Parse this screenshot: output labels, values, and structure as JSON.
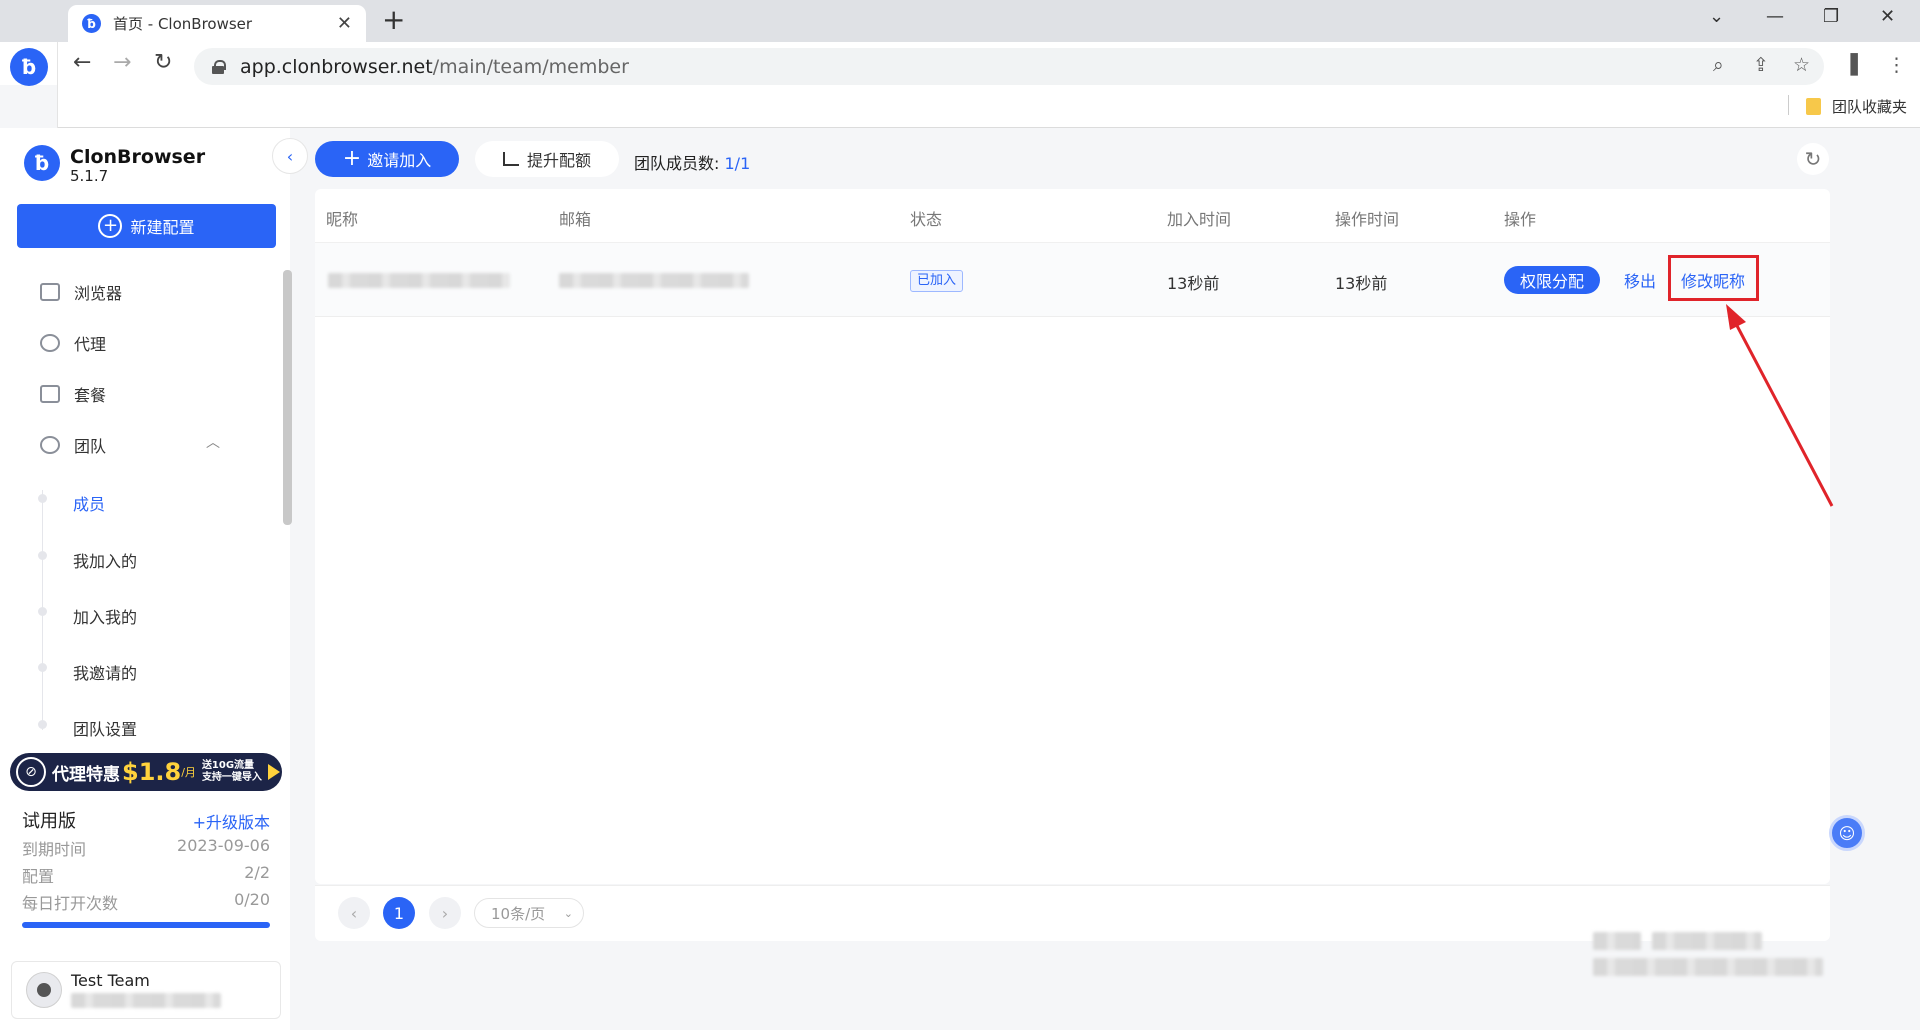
{
  "browser": {
    "tab_title": "首页 - ClonBrowser",
    "favicon_glyph": "ƀ",
    "new_tab": "+",
    "url_host": "app.clonbrowser.net",
    "url_path": "/main/team/member",
    "bookmark_folder": "团队收藏夹",
    "icons": [
      "back-icon",
      "forward-icon",
      "reload-icon",
      "zoom-icon",
      "share-icon",
      "star-icon",
      "sidepanel-icon",
      "menu-icon"
    ]
  },
  "sidebar": {
    "brand_name": "ClonBrowser",
    "version": "5.1.7",
    "new_config_label": "新建配置",
    "nav": [
      {
        "label": "浏览器",
        "icon": "browser-icon"
      },
      {
        "label": "代理",
        "icon": "globe-icon"
      },
      {
        "label": "套餐",
        "icon": "wallet-icon"
      },
      {
        "label": "团队",
        "icon": "team-icon"
      }
    ],
    "team_sub": [
      "成员",
      "我加入的",
      "加入我的",
      "我邀请的",
      "团队设置"
    ],
    "promo": {
      "text": "代理特惠",
      "price": "$1.8",
      "unit": "/月",
      "line1": "送10G流量",
      "line2": "支持一键导入"
    },
    "plan": {
      "title": "试用版",
      "upgrade": "+升级版本",
      "rows": [
        {
          "label": "到期时间",
          "value": "2023-09-06"
        },
        {
          "label": "配置",
          "value": "2/2"
        },
        {
          "label": "每日打开次数",
          "value": "0/20"
        }
      ]
    },
    "user": {
      "name": "Test Team"
    }
  },
  "main": {
    "invite_label": "邀请加入",
    "quota_label": "提升配额",
    "member_count_label": "团队成员数:",
    "member_count_value": "1/1",
    "columns": [
      "昵称",
      "邮箱",
      "状态",
      "加入时间",
      "操作时间",
      "操作"
    ],
    "rows": [
      {
        "status": "已加入",
        "join_time": "13秒前",
        "op_time": "13秒前",
        "actions": {
          "perm": "权限分配",
          "remove": "移出",
          "rename": "修改昵称"
        }
      }
    ],
    "pagination": {
      "current": "1",
      "page_size": "10条/页"
    }
  },
  "colors": {
    "accent": "#2a64f6",
    "highlight": "#e0242a"
  }
}
